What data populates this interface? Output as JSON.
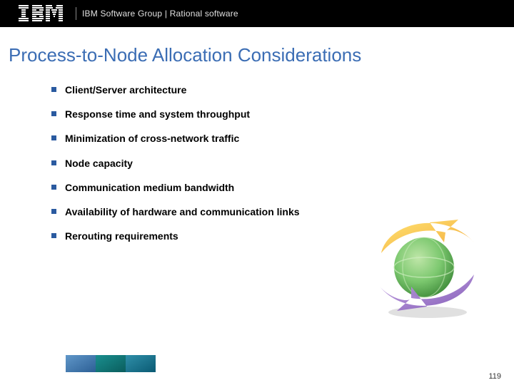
{
  "header": {
    "brand": "IBM",
    "group_text": "IBM Software Group | Rational software"
  },
  "title": "Process-to-Node Allocation Considerations",
  "bullets": [
    "Client/Server architecture",
    "Response time and system throughput",
    "Minimization of cross-network traffic",
    "Node capacity",
    "Communication medium bandwidth",
    "Availability of hardware and communication links",
    "Rerouting requirements"
  ],
  "page_number": "119",
  "colors": {
    "title": "#3b6db4",
    "bullet_square": "#2a5aa0"
  }
}
